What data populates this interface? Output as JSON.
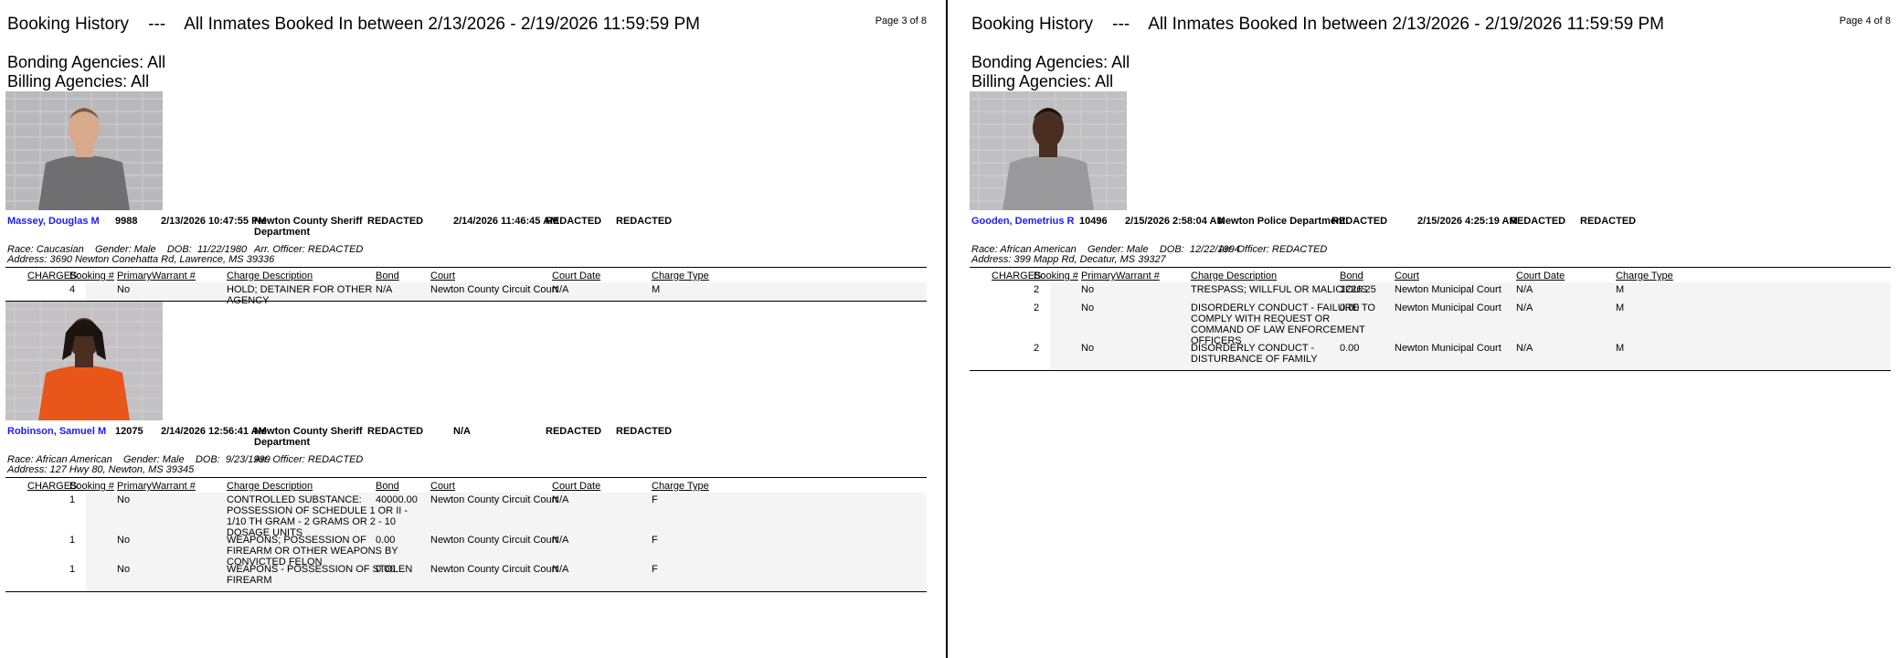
{
  "pages": [
    {
      "title": "Booking History    ---    All Inmates Booked In between 2/13/2026 - 2/19/2026 11:59:59 PM",
      "page_label": "Page 3 of 8",
      "bonding": "Bonding Agencies: All",
      "billing": "Billing Agencies: All",
      "records": [
        {
          "name": "Massey, Douglas M",
          "id": "9988",
          "booked": "2/13/2026 10:47:55 PM",
          "agency": "Newton County Sheriff Department",
          "col5": "REDACTED",
          "released": "2/14/2026 11:46:45 AM",
          "col7": "REDACTED",
          "col8": "REDACTED",
          "race_line": "Race: Caucasian    Gender: Male    DOB:  11/22/1980",
          "address": "Address: 3690 Newton Conehatta Rd, Lawrence, MS 39336",
          "officer": "Arr. Officer: REDACTED",
          "photo_bg": "#b9b9bb",
          "shirt": "#6f6f72",
          "charges": [
            {
              "booking": "4",
              "primary": "No",
              "warrant": "",
              "desc": "HOLD; DETAINER FOR OTHER AGENCY",
              "bond": "N/A",
              "court": "Newton County Circuit Court",
              "court_date": "N/A",
              "type": "M"
            }
          ]
        },
        {
          "name": "Robinson, Samuel M",
          "id": "12075",
          "booked": "2/14/2026 12:56:41 AM",
          "agency": "Newton County Sheriff Department",
          "col5": "REDACTED",
          "released": "N/A",
          "col7": "REDACTED",
          "col8": "REDACTED",
          "race_line": "Race: African American    Gender: Male    DOB:  9/23/1999",
          "address": "Address: 127 Hwy 80, Newton, MS 39345",
          "officer": "Arr. Officer: REDACTED",
          "photo_bg": "#c3c1c4",
          "shirt": "#e8561a",
          "charges": [
            {
              "booking": "1",
              "primary": "No",
              "warrant": "",
              "desc": "CONTROLLED SUBSTANCE: POSSESSION OF SCHEDULE 1 OR II - 1/10 TH GRAM - 2 GRAMS OR 2 - 10 DOSAGE UNITS",
              "bond": "40000.00",
              "court": "Newton County Circuit Court",
              "court_date": "N/A",
              "type": "F"
            },
            {
              "booking": "1",
              "primary": "No",
              "warrant": "",
              "desc": "WEAPONS; POSSESSION OF FIREARM OR OTHER WEAPONS BY CONVICTED FELON",
              "bond": "0.00",
              "court": "Newton County Circuit Court",
              "court_date": "N/A",
              "type": "F"
            },
            {
              "booking": "1",
              "primary": "No",
              "warrant": "",
              "desc": "WEAPONS - POSSESSION OF STOLEN FIREARM",
              "bond": "0.00",
              "court": "Newton County Circuit Court",
              "court_date": "N/A",
              "type": "F"
            }
          ]
        }
      ]
    },
    {
      "title": "Booking History    ---    All Inmates Booked In between 2/13/2026 - 2/19/2026 11:59:59 PM",
      "page_label": "Page 4 of 8",
      "bonding": "Bonding Agencies: All",
      "billing": "Billing Agencies: All",
      "records": [
        {
          "name": "Gooden, Demetrius R",
          "id": "10496",
          "booked": "2/15/2026 2:58:04 AM",
          "agency": "Newton Police Department",
          "col5": "REDACTED",
          "released": "2/15/2026 4:25:19 AM",
          "col7": "REDACTED",
          "col8": "REDACTED",
          "race_line": "Race: African American    Gender: Male    DOB:  12/22/1994",
          "address": "Address: 399 Mapp Rd, Decatur, MS 39327",
          "officer": "Arr. Officer: REDACTED",
          "photo_bg": "#c0bfc1",
          "shirt": "#9a9a9c",
          "charges": [
            {
              "booking": "2",
              "primary": "No",
              "warrant": "",
              "desc": "TRESPASS; WILLFUL OR MALICIOUS",
              "bond": "1226.25",
              "court": "Newton Municipal Court",
              "court_date": "N/A",
              "type": "M"
            },
            {
              "booking": "2",
              "primary": "No",
              "warrant": "",
              "desc": "DISORDERLY CONDUCT - FAILURE TO COMPLY WITH REQUEST OR COMMAND OF LAW ENFORCEMENT OFFICERS",
              "bond": "0.00",
              "court": "Newton Municipal Court",
              "court_date": "N/A",
              "type": "M"
            },
            {
              "booking": "2",
              "primary": "No",
              "warrant": "",
              "desc": "DISORDERLY CONDUCT - DISTURBANCE OF FAMILY",
              "bond": "0.00",
              "court": "Newton Municipal Court",
              "court_date": "N/A",
              "type": "M"
            }
          ]
        }
      ]
    }
  ],
  "charge_headers": {
    "charges": "CHARGES:",
    "booking": "Booking #",
    "primary": "Primary",
    "warrant": "Warrant #",
    "desc": "Charge Description",
    "bond": "Bond",
    "court": "Court",
    "court_date": "Court Date",
    "type": "Charge Type"
  }
}
